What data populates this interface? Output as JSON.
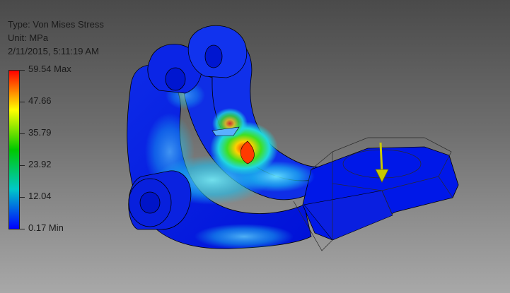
{
  "header": {
    "type_line": "Type: Von Mises Stress",
    "unit_line": "Unit: MPa",
    "timestamp": "2/11/2015, 5:11:19 AM"
  },
  "legend": {
    "labels": [
      "59.54 Max",
      "47.66",
      "35.79",
      "23.92",
      "12.04",
      "0.17 Min"
    ],
    "max": 59.54,
    "min": 0.17,
    "colors": [
      "#ff0000",
      "#ffff00",
      "#00c800",
      "#00c8c8",
      "#0000ff"
    ]
  },
  "model": {
    "base_color": "#0019e0",
    "hotspot_color": "#ff1a00",
    "load_arrow_color": "#c8c800"
  }
}
